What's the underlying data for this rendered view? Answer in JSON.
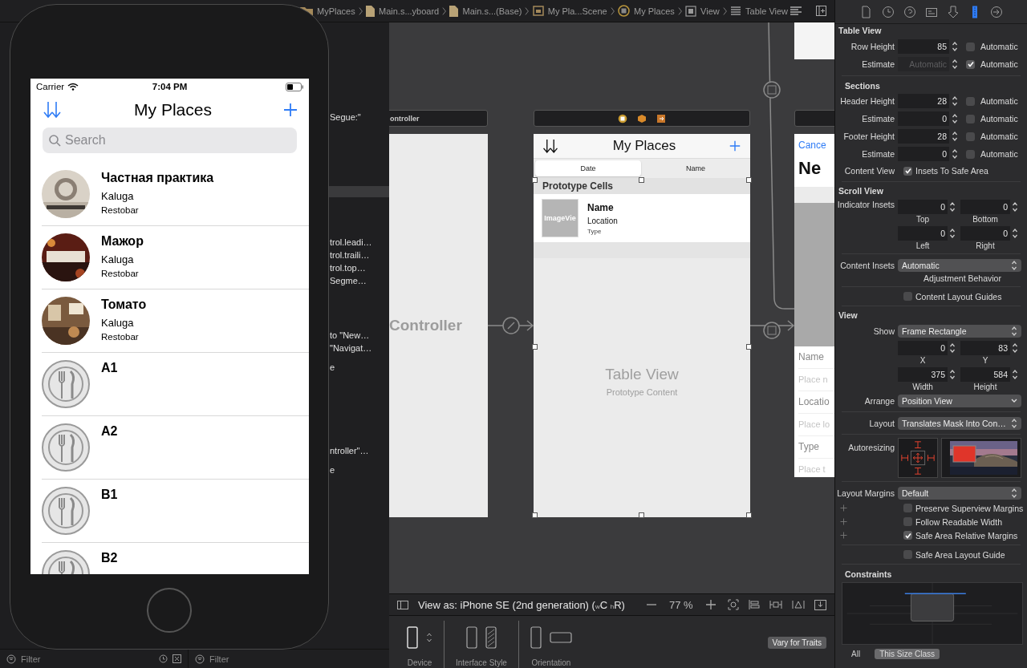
{
  "toolbar": {
    "breadcrumbs": [
      {
        "label": "MyPlaces",
        "kind": "folder"
      },
      {
        "label": "Main.s...yboard",
        "kind": "file"
      },
      {
        "label": "Main.s...(Base)",
        "kind": "file"
      },
      {
        "label": "My Pla...Scene",
        "kind": "scene"
      },
      {
        "label": "My Places",
        "kind": "controller"
      },
      {
        "label": "View",
        "kind": "view"
      },
      {
        "label": "Table View",
        "kind": "table"
      }
    ]
  },
  "outline": {
    "rows": [
      {
        "text": "Segue:\""
      },
      {
        "text": "trol.leadi…"
      },
      {
        "text": "trol.traili…"
      },
      {
        "text": "trol.top…"
      },
      {
        "text": "Segme…"
      },
      {
        "text": "to \"New…"
      },
      {
        "text": "\"Navigat…"
      },
      {
        "text": "e"
      },
      {
        "text": "ntroller\"…"
      },
      {
        "text": "e"
      }
    ]
  },
  "filters": [
    {
      "placeholder": "Filter"
    },
    {
      "placeholder": "Filter"
    }
  ],
  "simulator": {
    "carrier": "Carrier",
    "time": "7:04 PM",
    "title": "My Places",
    "search": {
      "placeholder": "Search"
    },
    "places": [
      {
        "name": "Частная практика",
        "location": "Kaluga",
        "type": "Restobar"
      },
      {
        "name": "Мажор",
        "location": "Kaluga",
        "type": "Restobar"
      },
      {
        "name": "Томато",
        "location": "Kaluga",
        "type": "Restobar"
      },
      {
        "name": "A1",
        "kind": "placeholder"
      },
      {
        "name": "A2",
        "kind": "placeholder"
      },
      {
        "name": "B1",
        "kind": "placeholder"
      },
      {
        "name": "B2",
        "kind": "placeholder"
      }
    ]
  },
  "canvas": {
    "left_scene": {
      "header": "ontroller",
      "title": "Controller"
    },
    "main_scene": {
      "title": "My Places",
      "segments": [
        {
          "label": "Date",
          "selected": true
        },
        {
          "label": "Name",
          "selected": false
        }
      ],
      "section_header": "Prototype Cells",
      "cell": {
        "image": "ImageVie",
        "name": "Name",
        "location": "Location",
        "type": "Type"
      },
      "placeholder_title": "Table View",
      "placeholder_subtitle": "Prototype Content"
    },
    "right_scene": {
      "cancel": "Cance",
      "title": "Ne",
      "fields": [
        {
          "label": "Name",
          "placeholder": "Place n"
        },
        {
          "label": "Locatio",
          "placeholder": "Place lo"
        },
        {
          "label": "Type",
          "placeholder": "Place t"
        }
      ]
    }
  },
  "view_as_bar": {
    "label": "View as: iPhone SE (2nd generation) ($_{w}$C $_{h}$R)",
    "zoom": "77 %"
  },
  "device_panel": {
    "groups": [
      {
        "label": "Device"
      },
      {
        "label": "Interface Style"
      },
      {
        "label": "Orientation"
      }
    ],
    "vary_button": "Vary for Traits"
  },
  "inspector": {
    "tabs": [
      {
        "kind": "file",
        "selected": false
      },
      {
        "kind": "history",
        "selected": false
      },
      {
        "kind": "help",
        "selected": false
      },
      {
        "kind": "identity",
        "selected": false
      },
      {
        "kind": "attributes",
        "selected": false
      },
      {
        "kind": "size",
        "selected": true
      },
      {
        "kind": "connections",
        "selected": false
      }
    ],
    "rows": [
      {
        "kind": "heading",
        "text": "Table View"
      },
      {
        "kind": "field",
        "label": "Row Height",
        "value": "85",
        "checked": false,
        "check_label": "Automatic"
      },
      {
        "kind": "field",
        "label": "Estimate",
        "placeholder": "Automatic",
        "checked": true,
        "check_label": "Automatic"
      },
      {
        "kind": "separator"
      },
      {
        "kind": "subheading",
        "text": "Sections"
      },
      {
        "kind": "field",
        "label": "Header Height",
        "value": "28",
        "checked": false,
        "check_label": "Automatic"
      },
      {
        "kind": "field",
        "label": "Estimate",
        "value": "0",
        "checked": false,
        "check_label": "Automatic"
      },
      {
        "kind": "field",
        "label": "Footer Height",
        "value": "28",
        "checked": false,
        "check_label": "Automatic"
      },
      {
        "kind": "field",
        "label": "Estimate",
        "value": "0",
        "checked": false,
        "check_label": "Automatic"
      },
      {
        "kind": "checkbox",
        "label": "Content View",
        "text": "Insets To Safe Area",
        "checked": true,
        "plus": false
      },
      {
        "kind": "separator"
      },
      {
        "kind": "heading",
        "text": "Scroll View"
      },
      {
        "kind": "pair",
        "label": "Indicator Insets",
        "fields": [
          {
            "value": "0",
            "caption": "Top"
          },
          {
            "value": "0",
            "caption": "Bottom"
          }
        ]
      },
      {
        "kind": "pair",
        "fields": [
          {
            "value": "0",
            "caption": "Left"
          },
          {
            "value": "0",
            "caption": "Right"
          }
        ]
      },
      {
        "kind": "separator"
      },
      {
        "kind": "select",
        "label": "Content Insets",
        "value": "Automatic",
        "caption": "Adjustment Behavior",
        "pulldown": false
      },
      {
        "kind": "separator"
      },
      {
        "kind": "checkbox",
        "text": "Content Layout Guides",
        "checked": false,
        "plus": false
      },
      {
        "kind": "separator"
      },
      {
        "kind": "heading",
        "text": "View"
      },
      {
        "kind": "select",
        "label": "Show",
        "value": "Frame Rectangle",
        "pulldown": false
      },
      {
        "kind": "pair",
        "fields": [
          {
            "value": "0",
            "caption": "X"
          },
          {
            "value": "83",
            "caption": "Y"
          }
        ]
      },
      {
        "kind": "pair",
        "fields": [
          {
            "value": "375",
            "caption": "Width"
          },
          {
            "value": "584",
            "caption": "Height"
          }
        ]
      },
      {
        "kind": "select",
        "label": "Arrange",
        "value": "Position View",
        "pulldown": true
      },
      {
        "kind": "separator"
      },
      {
        "kind": "select",
        "label": "Layout",
        "value": "Translates Mask Into Con…",
        "pulldown": false
      },
      {
        "kind": "separator"
      },
      {
        "kind": "autoresizing",
        "label": "Autoresizing"
      },
      {
        "kind": "separator"
      },
      {
        "kind": "select",
        "label": "Layout Margins",
        "value": "Default",
        "pulldown": false
      },
      {
        "kind": "checkbox",
        "text": "Preserve Superview Margins",
        "checked": false,
        "plus": true
      },
      {
        "kind": "checkbox",
        "text": "Follow Readable Width",
        "checked": false,
        "plus": true
      },
      {
        "kind": "checkbox",
        "text": "Safe Area Relative Margins",
        "checked": true,
        "plus": true
      },
      {
        "kind": "separator"
      },
      {
        "kind": "checkbox",
        "text": "Safe Area Layout Guide",
        "checked": false,
        "plus": false
      },
      {
        "kind": "separator"
      },
      {
        "kind": "constraints",
        "text": "Constraints",
        "buttons": [
          {
            "label": "All",
            "selected": false
          },
          {
            "label": "This Size Class",
            "selected": true
          }
        ]
      }
    ]
  }
}
